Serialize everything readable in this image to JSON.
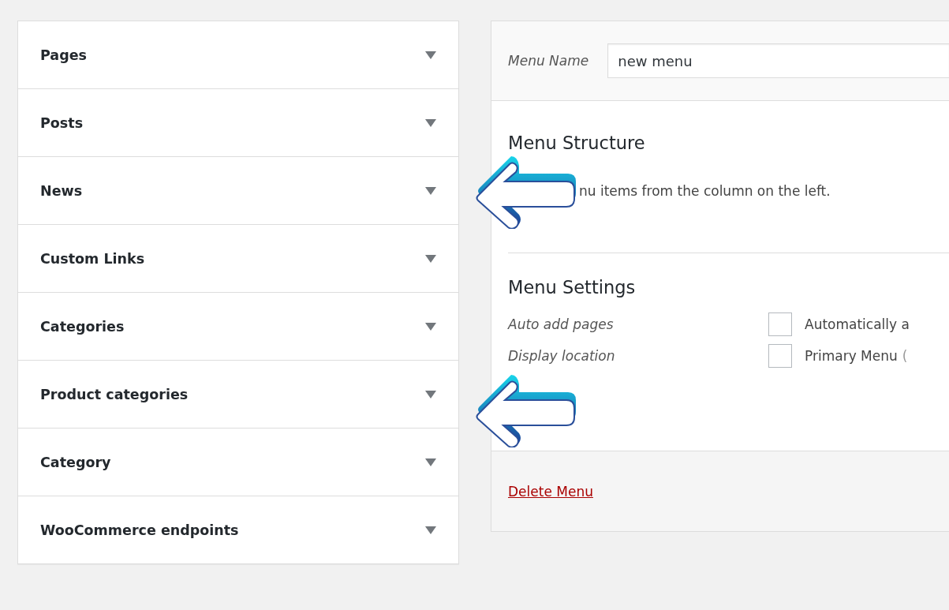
{
  "accordion": [
    {
      "label": "Pages",
      "expanded": false
    },
    {
      "label": "Posts",
      "expanded": false
    },
    {
      "label": "News",
      "expanded": false
    },
    {
      "label": "Custom Links",
      "expanded": false
    },
    {
      "label": "Categories",
      "expanded": false
    },
    {
      "label": "Product categories",
      "expanded": false
    },
    {
      "label": "Category",
      "expanded": false
    },
    {
      "label": "WooCommerce endpoints",
      "expanded": false
    }
  ],
  "menu_name": {
    "label": "Menu Name",
    "value": "new menu"
  },
  "structure": {
    "title": "Menu Structure",
    "instructions": "nu items from the column on the left."
  },
  "settings": {
    "title": "Menu Settings",
    "rows": [
      {
        "label": "Auto add pages",
        "option": "Automatically a",
        "checked": false
      },
      {
        "label": "Display location",
        "option": "Primary Menu",
        "note": "(",
        "checked": false
      }
    ]
  },
  "delete_link": "Delete Menu"
}
